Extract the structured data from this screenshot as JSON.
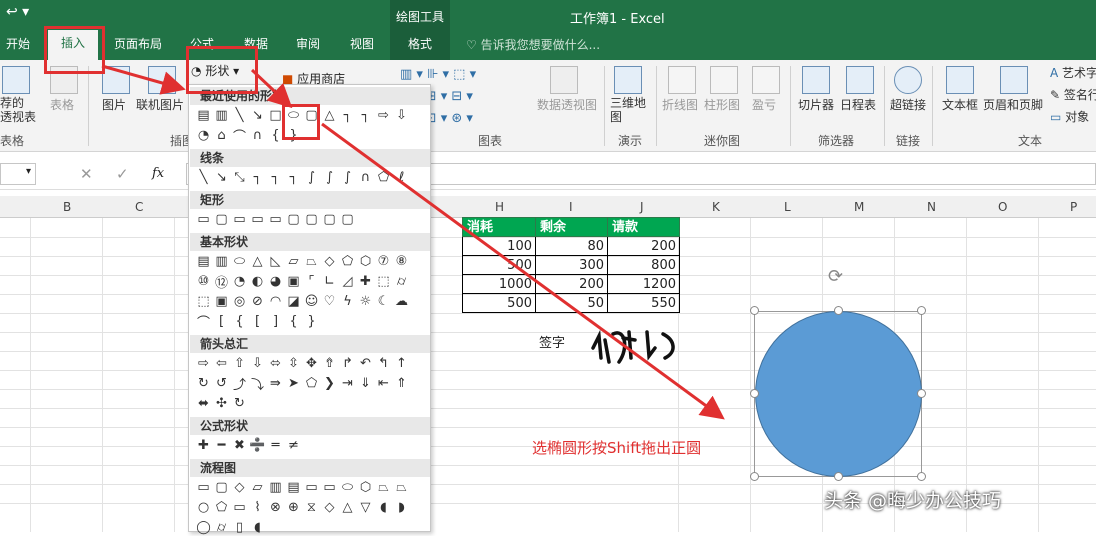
{
  "titlebar": {
    "context_tab_group": "绘图工具",
    "window_title": "工作簿1 - Excel",
    "tabs": [
      "开始",
      "插入",
      "页面布局",
      "公式",
      "数据",
      "审阅",
      "视图",
      "格式"
    ],
    "active_tab": "插入",
    "tell_me_placeholder": "告诉我您想要做什么..."
  },
  "ribbon": {
    "recommended_pivot": "荐的\n透视表",
    "table": "表格",
    "picture": "图片",
    "online_picture": "联机图片",
    "shapes": "形状",
    "app_store": "应用商店",
    "pivot_chart": "数据透视图",
    "map_3d": "三维地\n图",
    "spark_line": "折线图",
    "spark_column": "柱形图",
    "spark_winloss": "盈亏",
    "slicer": "切片器",
    "timeline": "日程表",
    "hyperlink": "超链接",
    "textbox": "文本框",
    "header_footer": "页眉和页脚",
    "wordart": "艺术字",
    "signature": "签名行",
    "object": "对象",
    "group_table": "表格",
    "group_illus": "插图",
    "group_charts": "图表",
    "group_tours": "演示",
    "group_sparklines": "迷你图",
    "group_filters": "筛选器",
    "group_links": "链接",
    "group_text": "文本"
  },
  "formula": {
    "fx": "fx"
  },
  "dropdown": {
    "recent": "最近使用的形状",
    "lines": "线条",
    "rect": "矩形",
    "basic": "基本形状",
    "arrows": "箭头总汇",
    "equation": "公式形状",
    "flowchart": "流程图"
  },
  "columns": [
    "B",
    "C",
    "H",
    "I",
    "J",
    "K",
    "L",
    "M",
    "N",
    "O",
    "P"
  ],
  "table": {
    "headers": [
      "消耗",
      "剩余",
      "请款"
    ],
    "rows": [
      [
        "100",
        "80",
        "200"
      ],
      [
        "500",
        "300",
        "800"
      ],
      [
        "1000",
        "200",
        "1200"
      ],
      [
        "500",
        "50",
        "550"
      ]
    ]
  },
  "signature_label": "签字",
  "annotation": "选椭圆形按Shift拖出正圆",
  "watermark": "头条 @晦少办公技巧",
  "colors": {
    "excel_green": "#217346",
    "header_green": "#00a651",
    "annotation_red": "#e03030",
    "circle_fill": "#5b9bd5"
  }
}
